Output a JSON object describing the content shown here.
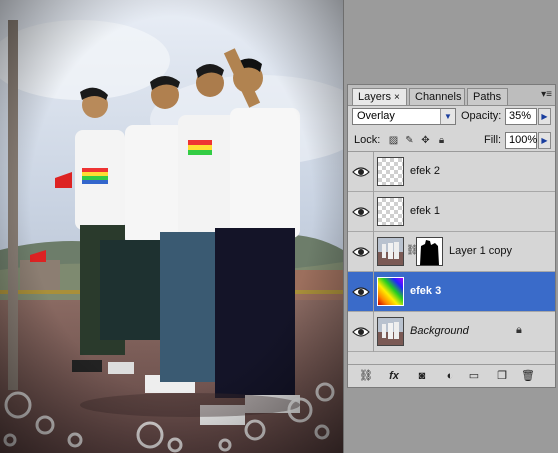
{
  "panel": {
    "tabs": [
      {
        "label": "Layers",
        "active": true,
        "close": "×"
      },
      {
        "label": "Channels",
        "active": false
      },
      {
        "label": "Paths",
        "active": false
      }
    ],
    "menu_glyph": "▾≡"
  },
  "options": {
    "blend_mode": "Overlay",
    "opacity_label": "Opacity:",
    "opacity_value": "35%",
    "lock_label": "Lock:",
    "fill_label": "Fill:",
    "fill_value": "100%"
  },
  "layers": [
    {
      "name": "efek 2",
      "visible": true,
      "selected": false,
      "thumb": "transparent"
    },
    {
      "name": "efek 1",
      "visible": true,
      "selected": false,
      "thumb": "transparent"
    },
    {
      "name": "Layer 1 copy",
      "visible": true,
      "selected": false,
      "thumb": "photo",
      "mask": true
    },
    {
      "name": "efek 3",
      "visible": true,
      "selected": true,
      "thumb": "rainbow"
    },
    {
      "name": "Background",
      "visible": true,
      "selected": false,
      "thumb": "photo",
      "locked": true
    }
  ],
  "bottom_icons": [
    "link-icon",
    "fx-icon",
    "add-mask-icon",
    "adjustment-icon",
    "folder-icon",
    "new-layer-icon",
    "trash-icon"
  ],
  "colors": {
    "selection": "#3a6bc9",
    "panel": "#d6d6d6",
    "workspace": "#9b9b9b"
  }
}
